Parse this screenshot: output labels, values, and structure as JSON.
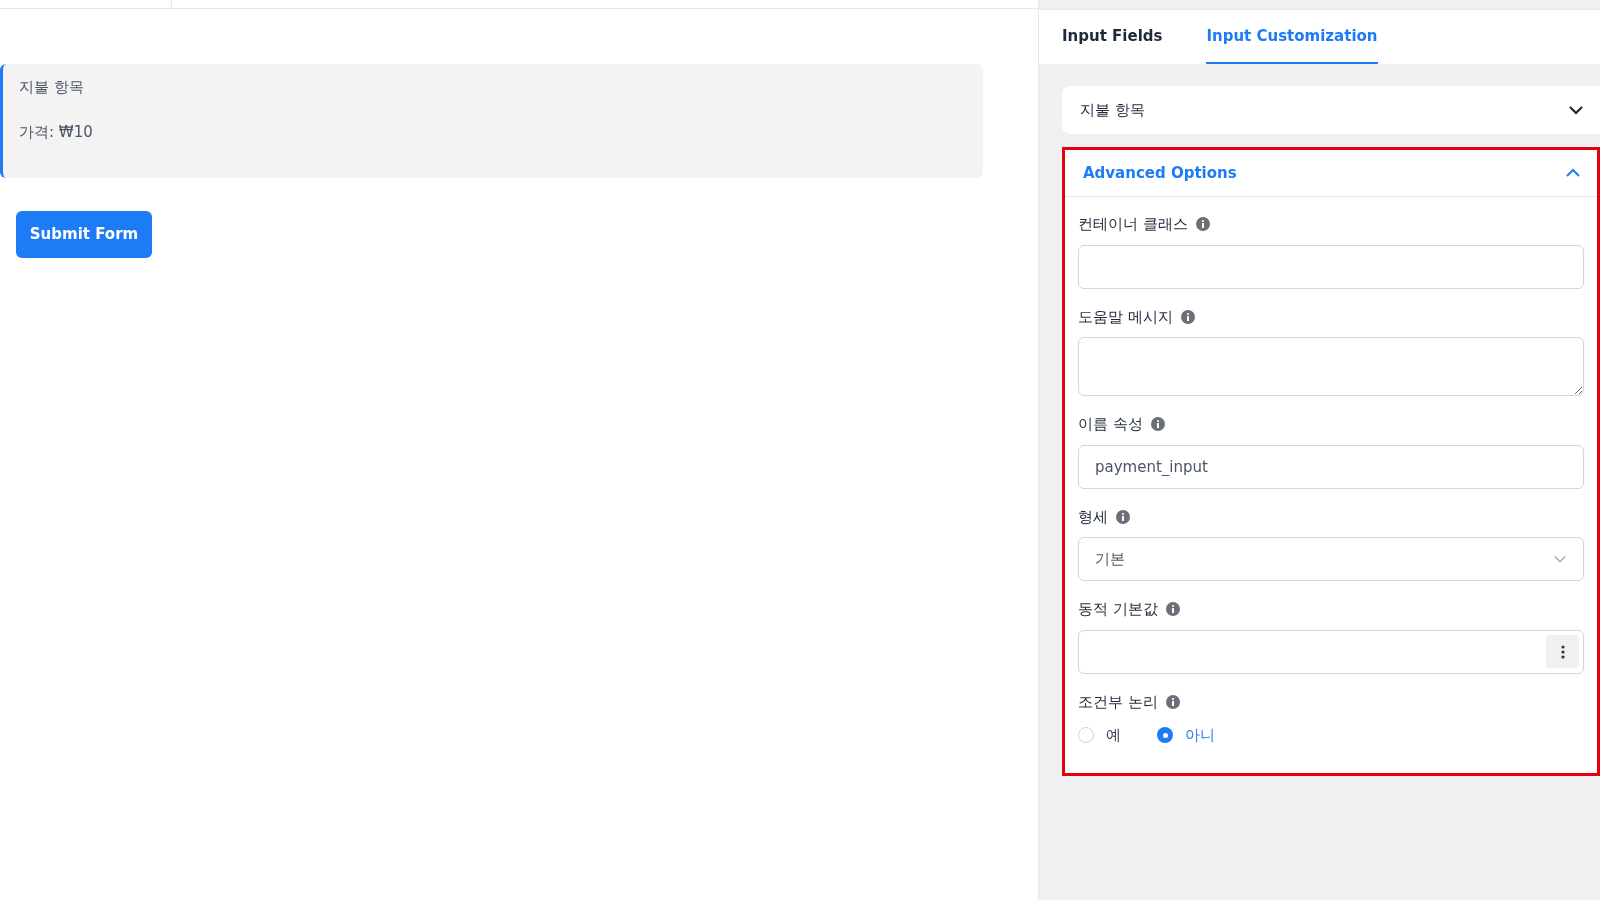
{
  "preview": {
    "title": "지불 항목",
    "price": "가격: ₩10"
  },
  "submit_button": "Submit Form",
  "tabs": [
    {
      "label": "Input Fields",
      "selected": false
    },
    {
      "label": "Input Customization",
      "selected": true
    }
  ],
  "accordions": [
    {
      "title": "지불 항목",
      "expanded": false
    },
    {
      "title": "Advanced Options",
      "expanded": true,
      "highlighted": true
    }
  ],
  "fields": [
    {
      "kind": "text",
      "label": "컨테이너 클래스"
    },
    {
      "kind": "textarea",
      "label": "도움말 메시지"
    },
    {
      "kind": "text",
      "label": "이름 속성",
      "value": "payment_input"
    },
    {
      "kind": "select",
      "label": "형세",
      "value": "기본"
    },
    {
      "kind": "menu",
      "label": "동적 기본값"
    },
    {
      "kind": "radio",
      "label": "조건부 논리",
      "options": [
        {
          "label": "예",
          "selected": false
        },
        {
          "label": "아니",
          "selected": true
        }
      ]
    }
  ]
}
